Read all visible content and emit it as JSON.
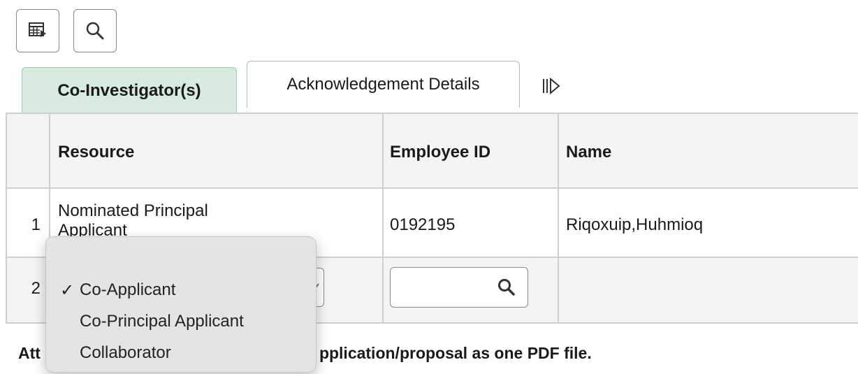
{
  "toolbar": {
    "grid_icon": "table-view-icon",
    "search_icon": "search-icon"
  },
  "tabs": [
    {
      "label": "Co-Investigator(s)",
      "active": true
    },
    {
      "label": "Acknowledgement Details",
      "active": false
    }
  ],
  "tabs_more_icon": "show-all-columns-icon",
  "table": {
    "headers": {
      "resource": "Resource",
      "employee_id": "Employee ID",
      "name": "Name"
    },
    "rows": [
      {
        "num": "1",
        "resource_line1": "Nominated Principal",
        "resource_line2": "Applicant",
        "employee_id": "0192195",
        "name": "Riqoxuip,Huhmioq"
      },
      {
        "num": "2",
        "resource_selected": "Co-Applicant",
        "employee_id": "",
        "name": ""
      }
    ]
  },
  "dropdown": {
    "options": [
      "Co-Applicant",
      "Co-Principal Applicant",
      "Collaborator"
    ],
    "selected": "Co-Applicant",
    "check_glyph": "✓"
  },
  "instructions": {
    "visible_prefix": "Att",
    "visible_suffix": "pplication/proposal as one PDF file."
  },
  "colors": {
    "active_tab_bg": "#d7ecdf",
    "header_bg": "#f4f4f4"
  }
}
